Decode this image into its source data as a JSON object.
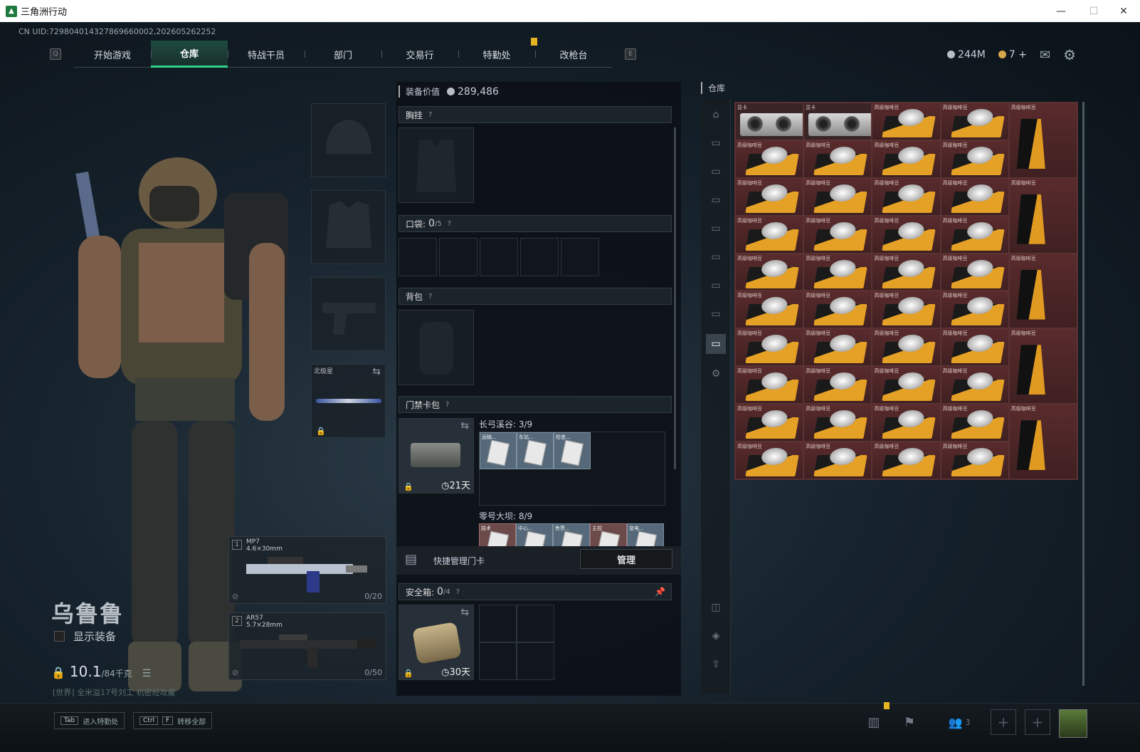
{
  "window": {
    "title": "三角洲行动",
    "minimize": "—",
    "maximize": "☐",
    "close": "✕"
  },
  "uid": "CN UID:729804014327869660002,202605262252",
  "nav": {
    "key_left": "Q",
    "key_right": "E",
    "tabs": [
      "开始游戏",
      "仓库",
      "特战干员",
      "部门",
      "交易行",
      "特勤处",
      "改枪台"
    ],
    "active_tab": "仓库"
  },
  "topbar": {
    "currency_silver": "244M",
    "currency_gold": "7",
    "add": "+"
  },
  "character": {
    "name": "乌鲁鲁",
    "show_equipment": "显示装备",
    "weight": "10.1",
    "weight_max": "/84千克",
    "world_msg_prefix": "[世界]",
    "world_msg": "全米溢17号刘工 机密经攻雇"
  },
  "slots": {
    "melee_name": "北极星"
  },
  "weapons": [
    {
      "index": "1",
      "name": "MP7",
      "caliber": "4.6×30mm",
      "ammo": "0/20"
    },
    {
      "index": "2",
      "name": "AR57",
      "caliber": "5.7×28mm",
      "ammo": "0/50"
    }
  ],
  "equipment": {
    "value_label": "装备价值",
    "value": "289,486",
    "chest_rig": "胸挂",
    "pockets_label": "口袋:",
    "pockets_count": "0",
    "pockets_max": "/5",
    "backpack": "背包",
    "keycard_case": "门禁卡包",
    "keycard_timer": "21天",
    "map1_label": "长弓溪谷: 3/9",
    "map1_cards": [
      "运输...",
      "车站...",
      "检查..."
    ],
    "map2_label": "零号大坝: 8/9",
    "map2_cards": [
      "技术",
      "中心...",
      "售票...",
      "主控",
      "变电..."
    ],
    "quick_manage": "快捷管理门卡",
    "manage_btn": "管理",
    "safe_label": "安全箱:",
    "safe_count": "0",
    "safe_max": "/4",
    "safe_timer": "30天",
    "help": "?"
  },
  "warehouse": {
    "title": "仓库",
    "item_label": "高级咖啡豆",
    "gpu_label": "显卡",
    "bag_label": "高级咖啡豆"
  },
  "bottom": {
    "hotkey1_key": "Tab",
    "hotkey1_label": "进入特勤处",
    "hotkey2_key1": "Ctrl",
    "hotkey2_key2": "F",
    "hotkey2_label": "转移全部",
    "friends_count": "3"
  }
}
